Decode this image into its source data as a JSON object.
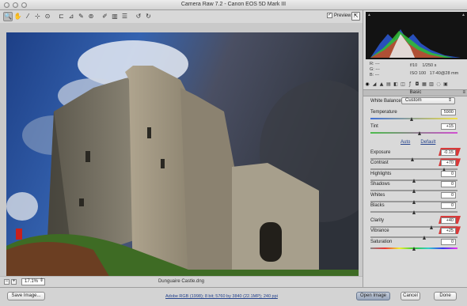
{
  "window": {
    "title": "Camera Raw 7.2  -  Canon EOS 5D Mark III"
  },
  "toolbar": {
    "tools": [
      {
        "icon": "zoom-icon",
        "glyph": "🔍",
        "active": true
      },
      {
        "icon": "hand-icon",
        "glyph": "✋"
      },
      {
        "icon": "white-balance-icon",
        "glyph": "⁄"
      },
      {
        "icon": "color-sampler-icon",
        "glyph": "⊹"
      },
      {
        "icon": "targeted-adjustment-icon",
        "glyph": "⊙"
      },
      {
        "icon": "crop-icon",
        "glyph": "⊏",
        "sep": true
      },
      {
        "icon": "straighten-icon",
        "glyph": "⊿"
      },
      {
        "icon": "spot-removal-icon",
        "glyph": "✎"
      },
      {
        "icon": "red-eye-icon",
        "glyph": "⊚"
      },
      {
        "icon": "adjustment-brush-icon",
        "glyph": "✐",
        "sep": true
      },
      {
        "icon": "graduated-filter-icon",
        "glyph": "▥"
      },
      {
        "icon": "open-preferences-icon",
        "glyph": "☰"
      },
      {
        "icon": "rotate-left-icon",
        "glyph": "↺",
        "sep": true
      },
      {
        "icon": "rotate-right-icon",
        "glyph": "↻"
      }
    ],
    "preview_label": "Preview",
    "preview_checked": "✓"
  },
  "status": {
    "zoom": "17.1%",
    "filename": "Dunguaire Castle.dng"
  },
  "metadata": {
    "rgb": [
      "R:  ---",
      "G:  ---",
      "B:  ---"
    ],
    "aperture": "f/10",
    "shutter": "1/250 s",
    "iso": "ISO 100",
    "focal": "17-40@28 mm"
  },
  "panel": {
    "title": "Basic",
    "white_balance_label": "White Balance:",
    "white_balance_value": "Custom",
    "auto": "Auto",
    "default": "Default",
    "sliders_top": [
      {
        "label": "Temperature",
        "value": "5900",
        "pos": 0.48,
        "track": "linear-gradient(90deg,#3f6fd6,#f1e04a)"
      },
      {
        "label": "Tint",
        "value": "+15",
        "pos": 0.57,
        "track": "linear-gradient(90deg,#4bbd4b,#d24fd2)"
      }
    ],
    "sliders": [
      {
        "label": "Exposure",
        "value": "-0.15",
        "pos": 0.49,
        "flag": true
      },
      {
        "label": "Contrast",
        "value": "+70",
        "pos": 0.85,
        "flag": true
      },
      {
        "label": "Highlights",
        "value": "0",
        "pos": 0.5
      },
      {
        "label": "Shadows",
        "value": "0",
        "pos": 0.5
      },
      {
        "label": "Whites",
        "value": "0",
        "pos": 0.5
      },
      {
        "label": "Blacks",
        "value": "0",
        "pos": 0.5
      }
    ],
    "sliders_presence": [
      {
        "label": "Clarity",
        "value": "+40",
        "pos": 0.7,
        "flag": true
      },
      {
        "label": "Vibrance",
        "value": "+25",
        "pos": 0.625,
        "flag": true
      },
      {
        "label": "Saturation",
        "value": "0",
        "pos": 0.5,
        "track": "linear-gradient(90deg,#888,#e33,#ee3,#3c3,#3cc,#33e,#e3e)"
      }
    ]
  },
  "footer": {
    "save": "Save Image...",
    "workflow": "Adobe RGB (1998); 8 bit; 5760 by 3840 (22.1MP); 240 ppi",
    "open": "Open Image",
    "cancel": "Cancel",
    "done": "Done"
  }
}
